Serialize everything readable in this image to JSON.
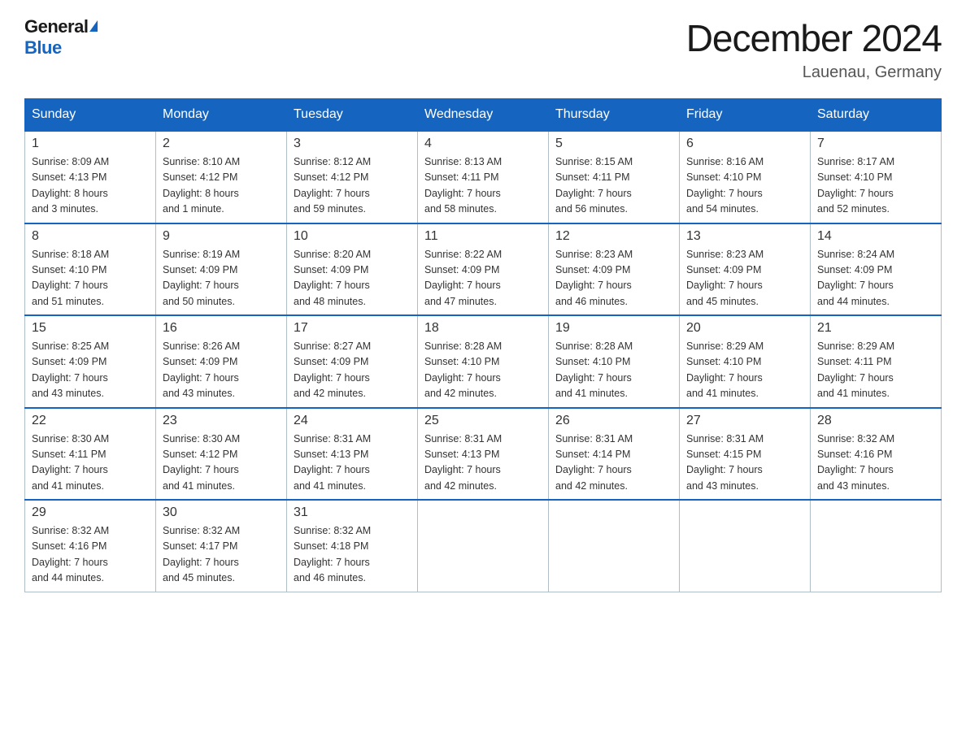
{
  "header": {
    "logo_general": "General",
    "logo_blue": "Blue",
    "month_title": "December 2024",
    "location": "Lauenau, Germany"
  },
  "days_of_week": [
    "Sunday",
    "Monday",
    "Tuesday",
    "Wednesday",
    "Thursday",
    "Friday",
    "Saturday"
  ],
  "weeks": [
    [
      {
        "day": "1",
        "sunrise": "8:09 AM",
        "sunset": "4:13 PM",
        "daylight": "8 hours and 3 minutes."
      },
      {
        "day": "2",
        "sunrise": "8:10 AM",
        "sunset": "4:12 PM",
        "daylight": "8 hours and 1 minute."
      },
      {
        "day": "3",
        "sunrise": "8:12 AM",
        "sunset": "4:12 PM",
        "daylight": "7 hours and 59 minutes."
      },
      {
        "day": "4",
        "sunrise": "8:13 AM",
        "sunset": "4:11 PM",
        "daylight": "7 hours and 58 minutes."
      },
      {
        "day": "5",
        "sunrise": "8:15 AM",
        "sunset": "4:11 PM",
        "daylight": "7 hours and 56 minutes."
      },
      {
        "day": "6",
        "sunrise": "8:16 AM",
        "sunset": "4:10 PM",
        "daylight": "7 hours and 54 minutes."
      },
      {
        "day": "7",
        "sunrise": "8:17 AM",
        "sunset": "4:10 PM",
        "daylight": "7 hours and 52 minutes."
      }
    ],
    [
      {
        "day": "8",
        "sunrise": "8:18 AM",
        "sunset": "4:10 PM",
        "daylight": "7 hours and 51 minutes."
      },
      {
        "day": "9",
        "sunrise": "8:19 AM",
        "sunset": "4:09 PM",
        "daylight": "7 hours and 50 minutes."
      },
      {
        "day": "10",
        "sunrise": "8:20 AM",
        "sunset": "4:09 PM",
        "daylight": "7 hours and 48 minutes."
      },
      {
        "day": "11",
        "sunrise": "8:22 AM",
        "sunset": "4:09 PM",
        "daylight": "7 hours and 47 minutes."
      },
      {
        "day": "12",
        "sunrise": "8:23 AM",
        "sunset": "4:09 PM",
        "daylight": "7 hours and 46 minutes."
      },
      {
        "day": "13",
        "sunrise": "8:23 AM",
        "sunset": "4:09 PM",
        "daylight": "7 hours and 45 minutes."
      },
      {
        "day": "14",
        "sunrise": "8:24 AM",
        "sunset": "4:09 PM",
        "daylight": "7 hours and 44 minutes."
      }
    ],
    [
      {
        "day": "15",
        "sunrise": "8:25 AM",
        "sunset": "4:09 PM",
        "daylight": "7 hours and 43 minutes."
      },
      {
        "day": "16",
        "sunrise": "8:26 AM",
        "sunset": "4:09 PM",
        "daylight": "7 hours and 43 minutes."
      },
      {
        "day": "17",
        "sunrise": "8:27 AM",
        "sunset": "4:09 PM",
        "daylight": "7 hours and 42 minutes."
      },
      {
        "day": "18",
        "sunrise": "8:28 AM",
        "sunset": "4:10 PM",
        "daylight": "7 hours and 42 minutes."
      },
      {
        "day": "19",
        "sunrise": "8:28 AM",
        "sunset": "4:10 PM",
        "daylight": "7 hours and 41 minutes."
      },
      {
        "day": "20",
        "sunrise": "8:29 AM",
        "sunset": "4:10 PM",
        "daylight": "7 hours and 41 minutes."
      },
      {
        "day": "21",
        "sunrise": "8:29 AM",
        "sunset": "4:11 PM",
        "daylight": "7 hours and 41 minutes."
      }
    ],
    [
      {
        "day": "22",
        "sunrise": "8:30 AM",
        "sunset": "4:11 PM",
        "daylight": "7 hours and 41 minutes."
      },
      {
        "day": "23",
        "sunrise": "8:30 AM",
        "sunset": "4:12 PM",
        "daylight": "7 hours and 41 minutes."
      },
      {
        "day": "24",
        "sunrise": "8:31 AM",
        "sunset": "4:13 PM",
        "daylight": "7 hours and 41 minutes."
      },
      {
        "day": "25",
        "sunrise": "8:31 AM",
        "sunset": "4:13 PM",
        "daylight": "7 hours and 42 minutes."
      },
      {
        "day": "26",
        "sunrise": "8:31 AM",
        "sunset": "4:14 PM",
        "daylight": "7 hours and 42 minutes."
      },
      {
        "day": "27",
        "sunrise": "8:31 AM",
        "sunset": "4:15 PM",
        "daylight": "7 hours and 43 minutes."
      },
      {
        "day": "28",
        "sunrise": "8:32 AM",
        "sunset": "4:16 PM",
        "daylight": "7 hours and 43 minutes."
      }
    ],
    [
      {
        "day": "29",
        "sunrise": "8:32 AM",
        "sunset": "4:16 PM",
        "daylight": "7 hours and 44 minutes."
      },
      {
        "day": "30",
        "sunrise": "8:32 AM",
        "sunset": "4:17 PM",
        "daylight": "7 hours and 45 minutes."
      },
      {
        "day": "31",
        "sunrise": "8:32 AM",
        "sunset": "4:18 PM",
        "daylight": "7 hours and 46 minutes."
      },
      null,
      null,
      null,
      null
    ]
  ],
  "labels": {
    "sunrise_prefix": "Sunrise: ",
    "sunset_prefix": "Sunset: ",
    "daylight_prefix": "Daylight: "
  }
}
